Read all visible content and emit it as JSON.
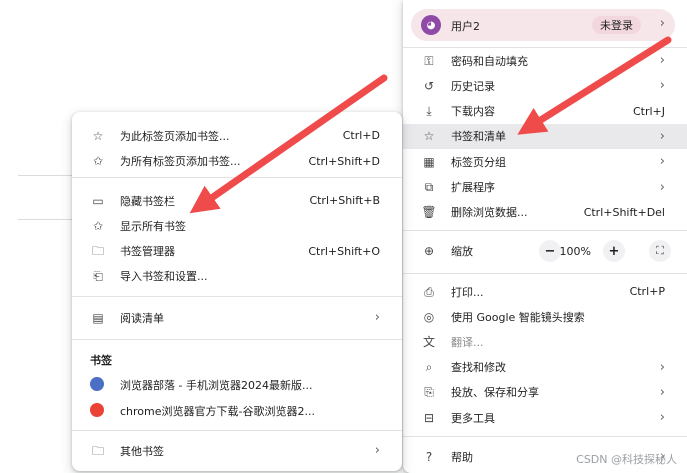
{
  "main_menu": {
    "profile": {
      "name": "用户2",
      "badge": "未登录"
    },
    "items_a": [
      {
        "label": "密码和自动填充",
        "shortcut": "",
        "icon": "key-icon",
        "glyph": "⚿",
        "submenu": true
      },
      {
        "label": "历史记录",
        "shortcut": "",
        "icon": "history-icon",
        "glyph": "↺",
        "submenu": true
      },
      {
        "label": "下载内容",
        "shortcut": "Ctrl+J",
        "icon": "download-icon",
        "glyph": "⤓",
        "submenu": false
      },
      {
        "label": "书签和清单",
        "shortcut": "",
        "icon": "star-icon",
        "glyph": "☆",
        "submenu": true,
        "highlighted": true
      },
      {
        "label": "标签页分组",
        "shortcut": "",
        "icon": "grid-icon",
        "glyph": "▦",
        "submenu": true
      },
      {
        "label": "扩展程序",
        "shortcut": "",
        "icon": "puzzle-icon",
        "glyph": "⧉",
        "submenu": true
      },
      {
        "label": "删除浏览数据...",
        "shortcut": "Ctrl+Shift+Del",
        "icon": "trash-icon",
        "glyph": "🗑",
        "submenu": false
      }
    ],
    "zoom": {
      "label": "缩放",
      "minus": "−",
      "value": "100%",
      "plus": "+",
      "fullscreen_glyph": "⛶"
    },
    "items_b": [
      {
        "label": "打印...",
        "shortcut": "Ctrl+P",
        "icon": "printer-icon",
        "glyph": "⎙",
        "submenu": false
      },
      {
        "label": "使用 Google 智能镜头搜索",
        "shortcut": "",
        "icon": "lens-icon",
        "glyph": "◎",
        "submenu": false
      },
      {
        "label": "翻译...",
        "shortcut": "",
        "icon": "translate-icon",
        "glyph": "文",
        "submenu": false,
        "disabled": true
      },
      {
        "label": "查找和修改",
        "shortcut": "",
        "icon": "find-icon",
        "glyph": "⌕",
        "submenu": true
      },
      {
        "label": "投放、保存和分享",
        "shortcut": "",
        "icon": "share-icon",
        "glyph": "⎘",
        "submenu": true
      },
      {
        "label": "更多工具",
        "shortcut": "",
        "icon": "toolbox-icon",
        "glyph": "⊟",
        "submenu": true
      }
    ],
    "help": {
      "label": "帮助",
      "glyph": "?",
      "submenu": true
    }
  },
  "sub_menu": {
    "items_a": [
      {
        "label": "为此标签页添加书签...",
        "shortcut": "Ctrl+D",
        "icon": "star-icon",
        "glyph": "☆"
      },
      {
        "label": "为所有标签页添加书签...",
        "shortcut": "Ctrl+Shift+D",
        "icon": "star-add-icon",
        "glyph": "✩"
      }
    ],
    "items_b": [
      {
        "label": "隐藏书签栏",
        "shortcut": "Ctrl+Shift+B",
        "icon": "bookmark-bar-icon",
        "glyph": "▭"
      },
      {
        "label": "显示所有书签",
        "shortcut": "",
        "icon": "star-list-icon",
        "glyph": "✩"
      },
      {
        "label": "书签管理器",
        "shortcut": "Ctrl+Shift+O",
        "icon": "folder-icon",
        "glyph": "🗀"
      },
      {
        "label": "导入书签和设置...",
        "shortcut": "",
        "icon": "import-icon",
        "glyph": "⎗"
      }
    ],
    "reading_list": {
      "label": "阅读清单",
      "glyph": "▤"
    },
    "bookmarks_title": "书签",
    "bookmarks": [
      {
        "label": "浏览器部落 - 手机浏览器2024最新版...",
        "icon": "site-favicon-icon",
        "color": "#4a6fc4"
      },
      {
        "label": "chrome浏览器官方下载-谷歌浏览器2...",
        "icon": "chrome-icon",
        "color": "#ea4335"
      }
    ],
    "other_bookmarks": {
      "label": "其他书签",
      "glyph": "🗀"
    }
  },
  "chevron": "›",
  "watermark": "CSDN @科技探秘人",
  "colors": {
    "arrow": "#ef4b4b",
    "profile_bg": "#f6e6ea",
    "highlight": "#e9e9ec"
  }
}
